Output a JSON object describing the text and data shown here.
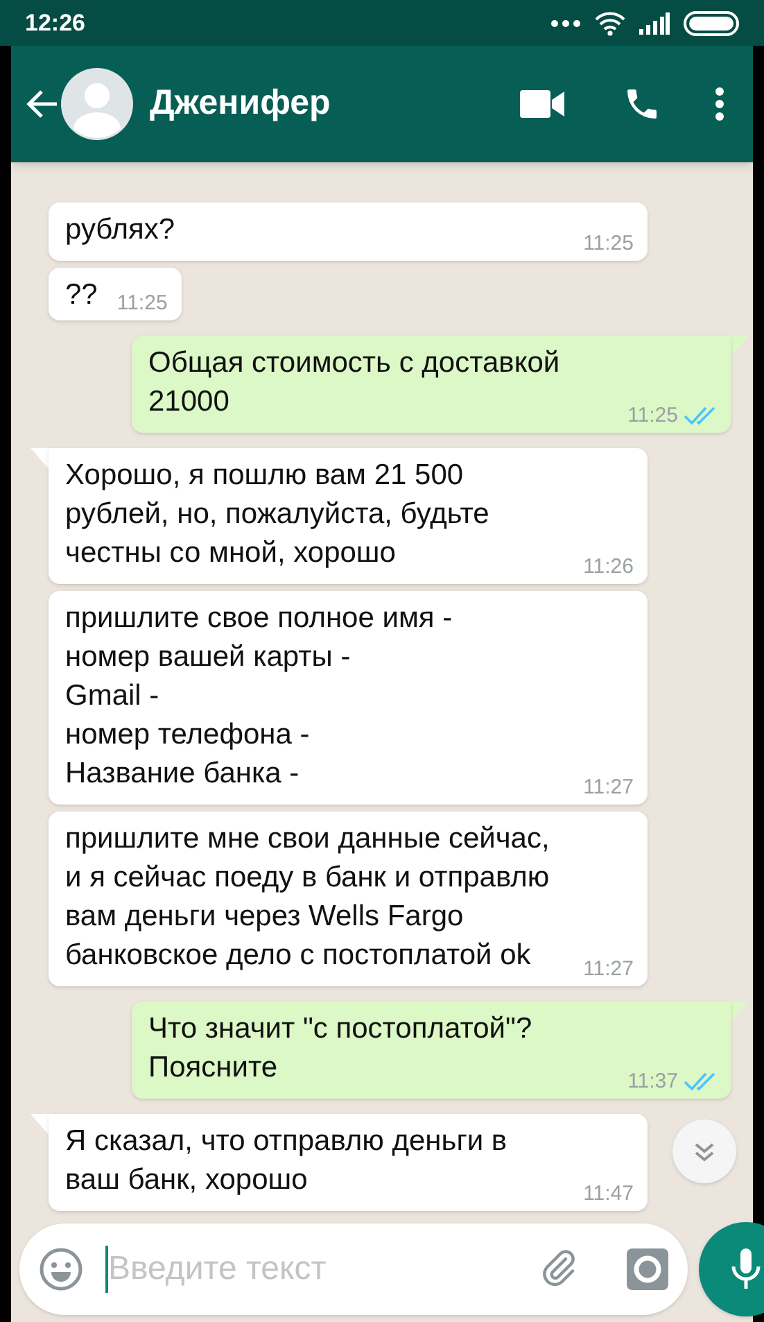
{
  "status_bar": {
    "time": "12:26"
  },
  "header": {
    "contact_name": "Дженифер"
  },
  "messages": [
    {
      "kind": "in",
      "tail": false,
      "wide": true,
      "text": "рублях?",
      "time": "11:25"
    },
    {
      "kind": "in",
      "tail": false,
      "wide": false,
      "text": "??",
      "time": "11:25"
    },
    {
      "kind": "out",
      "tail": true,
      "wide": true,
      "text": "Общая стоимость с доставкой\n21000",
      "time": "11:25",
      "read": true
    },
    {
      "kind": "in",
      "tail": true,
      "wide": true,
      "text": "Хорошо, я пошлю вам 21 500\nрублей, но, пожалуйста, будьте\nчестны со мной, хорошо",
      "time": "11:26"
    },
    {
      "kind": "in",
      "tail": false,
      "wide": true,
      "text": "пришлите свое полное имя -\nномер вашей карты -\nGmail -\nномер телефона -\nНазвание банка -",
      "time": "11:27"
    },
    {
      "kind": "in",
      "tail": false,
      "wide": true,
      "text": "пришлите мне свои данные сейчас,\nи я сейчас поеду в банк и отправлю\nвам деньги через Wells Fargo\nбанковское дело с постоплатой ok",
      "time": "11:27"
    },
    {
      "kind": "out",
      "tail": true,
      "wide": true,
      "text": "Что значит \"с постоплатой\"?\nПоясните",
      "time": "11:37",
      "read": true
    },
    {
      "kind": "in",
      "tail": true,
      "wide": true,
      "text": "Я сказал, что отправлю деньги в\nваш банк, хорошо",
      "time": "11:47"
    }
  ],
  "composer": {
    "placeholder": "Введите текст"
  }
}
